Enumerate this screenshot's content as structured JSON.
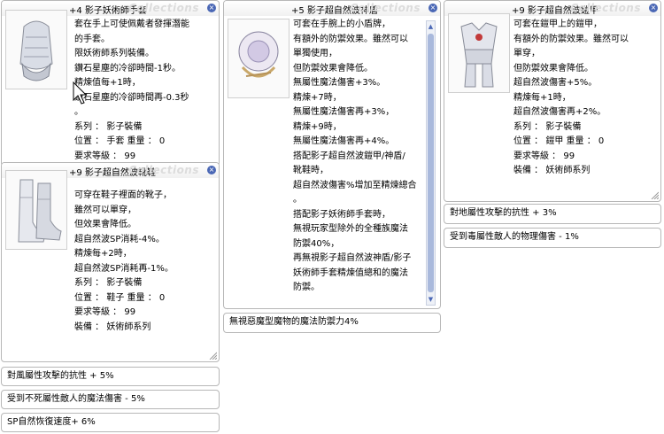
{
  "windows": [
    {
      "id": "gloves",
      "title": "+4 影子妖術師手套",
      "watermark": "Collections",
      "icon": "gauntlet-icon",
      "lines": [
        "套在手上可使佩戴者發揮潛能",
        "的手套。",
        "限妖術師系列裝備。",
        "鑽石星塵的冷卻時間-1秒。",
        "精煉值每+1時，",
        "鑽石星塵的冷卻時間再-0.3秒",
        "。",
        "系列 ： 影子裝備",
        "位置 ： 手套  重量 ： 0",
        "要求等級 ： 99"
      ]
    },
    {
      "id": "boots",
      "title": "+9 影子超自然波靴鞋",
      "watermark": "Collections",
      "icon": "boots-icon",
      "lines": [
        "可穿在鞋子裡面的靴子，",
        "雖然可以單穿，",
        "但效果會降低。",
        "超自然波SP消耗-4%。",
        "精煉每+2時，",
        "超自然波SP消耗再-1%。",
        "系列 ： 影子裝備",
        "位置 ： 鞋子  重量 ： 0",
        "要求等級 ： 99",
        "裝備 ： 妖術師系列"
      ]
    },
    {
      "id": "shield",
      "title": "+5 影子超自然波神盾",
      "watermark": "Collections",
      "icon": "shield-icon",
      "lines": [
        "可套在手腕上的小盾牌，",
        "有額外的防禦效果。雖然可以",
        "單獨使用，",
        "但防禦效果會降低。",
        "無屬性魔法傷害+3%。",
        "精煉+7時，",
        "無屬性魔法傷害再+3%，",
        "精煉+9時，",
        "無屬性魔法傷害再+4%。",
        "搭配影子超自然波鎧甲/神盾/",
        "靴鞋時，",
        "超自然波傷害%增加至精煉總合",
        "。",
        "搭配影子妖術師手套時，",
        "無視玩家型除外的全種族魔法",
        "防禦40%，",
        "再無視影子超自然波神盾/影子",
        "妖術師手套精煉值總和的魔法",
        "防禦。"
      ]
    },
    {
      "id": "armor",
      "title": "+9 影子超自然波鎧甲",
      "watermark": "Collections",
      "icon": "armor-icon",
      "lines": [
        "可套在鎧甲上的鎧甲，",
        "有額外的防禦效果。雖然可以",
        "單穿，",
        "但防禦效果會降低。",
        "超自然波傷害+5%。",
        "精煉每+1時，",
        "超自然波傷害再+2%。",
        "系列 ： 影子裝備",
        "位置 ： 鎧甲  重量 ： 0",
        "要求等級 ： 99",
        "裝備 ： 妖術師系列"
      ]
    }
  ],
  "bars": {
    "wind_resist": "對風屬性攻擊的抗性 + 5%",
    "undead_magic": "受到不死屬性敵人的魔法傷害 - 5%",
    "sp_regen": "SP自然恢復速度+ 6%",
    "ignore_mdef": "無視惡魔型魔物的魔法防禦力4%",
    "earth_resist": "對地屬性攻擊的抗性 + 3%",
    "poison_phys": "受到毒屬性敵人的物理傷害 - 1%"
  },
  "close_glyph": "×"
}
